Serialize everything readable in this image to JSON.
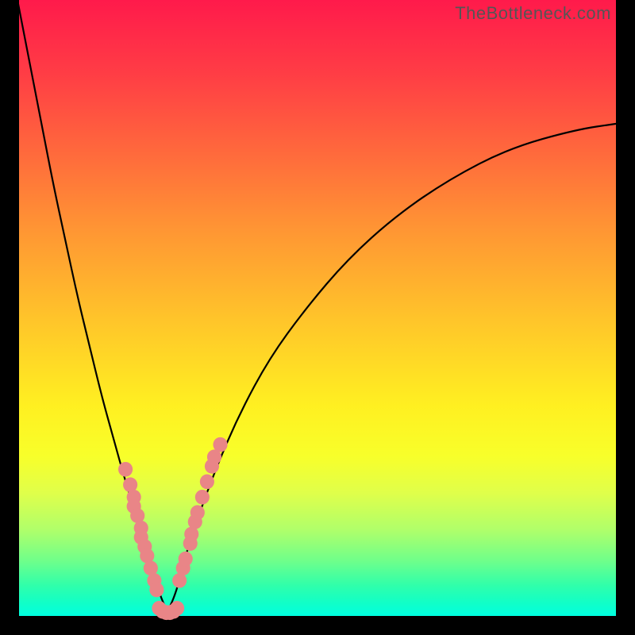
{
  "watermark": "TheBottleneck.com",
  "colors": {
    "dot": "#e98587",
    "curve": "#000000",
    "frame": "#000000",
    "gradient_top": "#ff1a4b",
    "gradient_bottom": "#00ffe0"
  },
  "chart_data": {
    "type": "line",
    "title": "",
    "xlabel": "",
    "ylabel": "",
    "xlim": [
      0,
      100
    ],
    "ylim": [
      0,
      100
    ],
    "series": [
      {
        "name": "left-curve",
        "x": [
          0,
          2,
          4,
          6,
          8,
          10,
          12,
          14,
          16,
          18,
          20,
          22,
          23,
          24,
          25
        ],
        "y": [
          100,
          90,
          80,
          70,
          61,
          52,
          44,
          36,
          29,
          22,
          16,
          10,
          6,
          3,
          1
        ]
      },
      {
        "name": "right-curve",
        "x": [
          25,
          26,
          27,
          28,
          30,
          33,
          37,
          42,
          48,
          55,
          63,
          72,
          82,
          93,
          100
        ],
        "y": [
          1,
          3,
          6,
          10,
          16,
          24,
          33,
          42,
          50,
          58,
          65,
          71,
          76,
          79,
          80
        ]
      },
      {
        "name": "valley-floor",
        "x": [
          23,
          24,
          25,
          26,
          27
        ],
        "y": [
          1.5,
          0.8,
          0.5,
          0.8,
          1.5
        ]
      }
    ],
    "markers": [
      {
        "name": "left-cluster",
        "series": "left-curve",
        "points": [
          {
            "x": 18.0,
            "y": 24.0
          },
          {
            "x": 18.8,
            "y": 21.5
          },
          {
            "x": 19.4,
            "y": 19.5
          },
          {
            "x": 19.4,
            "y": 18.0
          },
          {
            "x": 20.0,
            "y": 16.5
          },
          {
            "x": 20.6,
            "y": 14.5
          },
          {
            "x": 20.6,
            "y": 13.0
          },
          {
            "x": 21.2,
            "y": 11.5
          },
          {
            "x": 21.6,
            "y": 10.0
          },
          {
            "x": 22.2,
            "y": 8.0
          },
          {
            "x": 22.8,
            "y": 6.0
          },
          {
            "x": 23.2,
            "y": 4.5
          }
        ]
      },
      {
        "name": "right-cluster",
        "series": "right-curve",
        "points": [
          {
            "x": 27.0,
            "y": 6.0
          },
          {
            "x": 27.6,
            "y": 8.0
          },
          {
            "x": 28.0,
            "y": 9.5
          },
          {
            "x": 28.8,
            "y": 12.0
          },
          {
            "x": 29.0,
            "y": 13.5
          },
          {
            "x": 29.6,
            "y": 15.5
          },
          {
            "x": 30.0,
            "y": 17.0
          },
          {
            "x": 30.8,
            "y": 19.5
          },
          {
            "x": 31.6,
            "y": 22.0
          },
          {
            "x": 32.4,
            "y": 24.5
          },
          {
            "x": 32.8,
            "y": 26.0
          },
          {
            "x": 33.8,
            "y": 28.0
          }
        ]
      },
      {
        "name": "valley-cluster",
        "series": "valley-floor",
        "points": [
          {
            "x": 23.6,
            "y": 1.5
          },
          {
            "x": 24.2,
            "y": 1.0
          },
          {
            "x": 24.8,
            "y": 0.8
          },
          {
            "x": 25.4,
            "y": 0.8
          },
          {
            "x": 26.0,
            "y": 1.0
          },
          {
            "x": 26.6,
            "y": 1.5
          }
        ]
      }
    ]
  }
}
